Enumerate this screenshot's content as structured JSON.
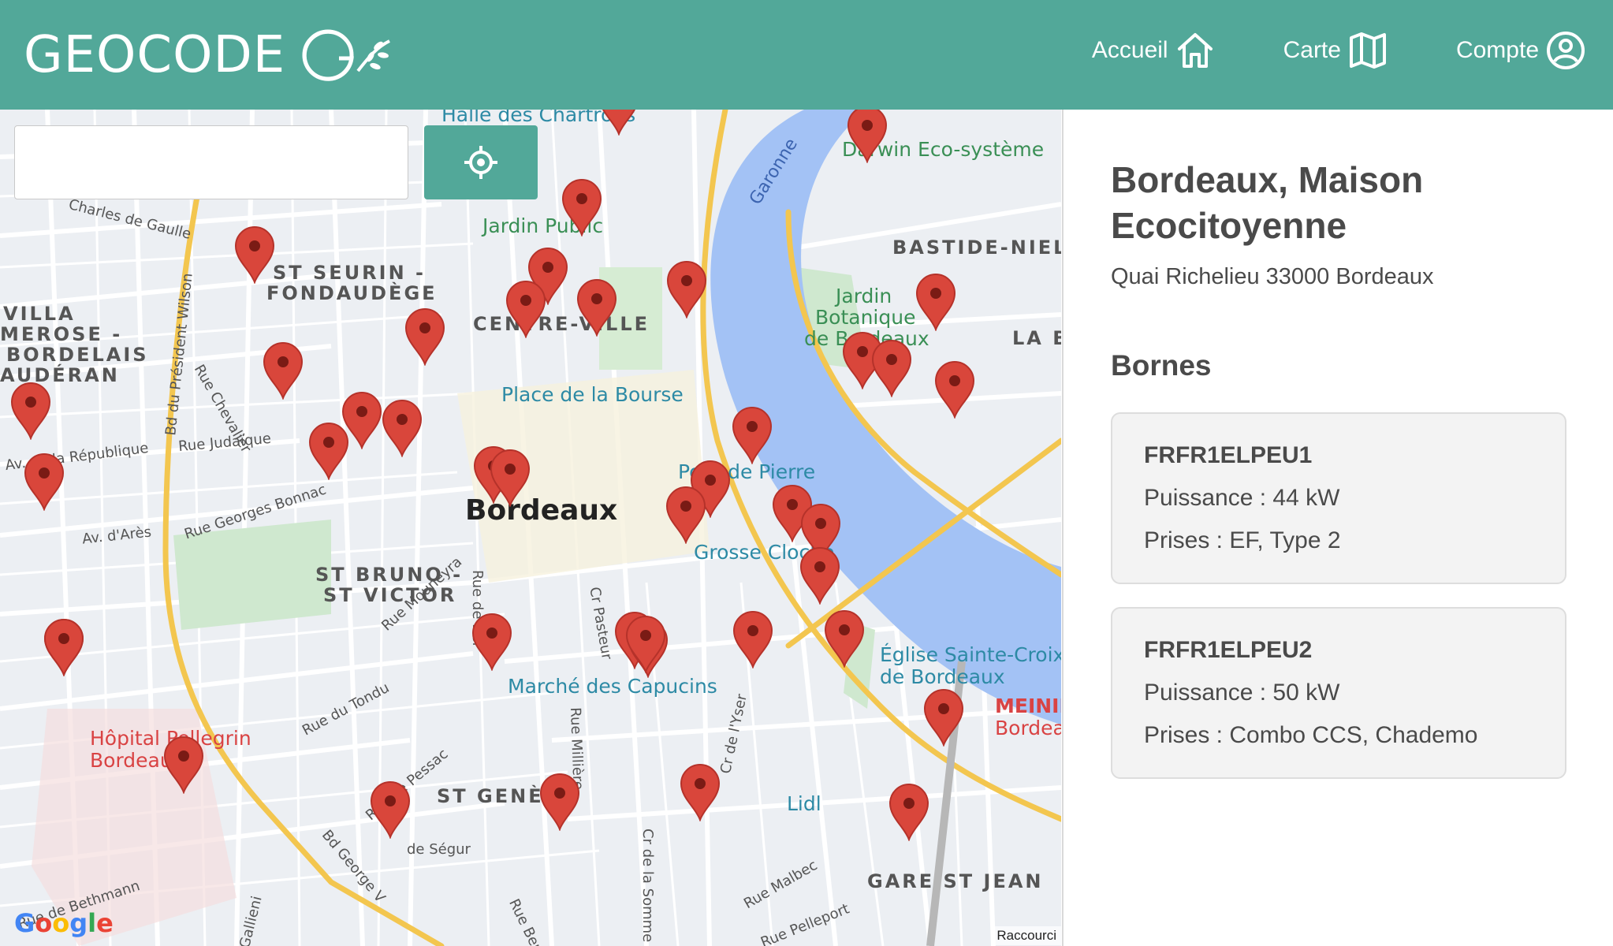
{
  "header": {
    "brand": "GEOCODE",
    "nav": [
      {
        "label": "Accueil",
        "icon": "home-icon"
      },
      {
        "label": "Carte",
        "icon": "map-icon"
      },
      {
        "label": "Compte",
        "icon": "account-icon"
      }
    ]
  },
  "map": {
    "search": {
      "value": "",
      "placeholder": ""
    },
    "districts": [
      "ST SEURIN -",
      "FONDAUDÈGE",
      "VILLA",
      "MEROSE -",
      "BORDELAIS",
      "AUDÉRAN",
      "CENTRE-VILLE",
      "BASTIDE-NIEL",
      "ST BRUNO -",
      "ST VICTOR",
      "ST GENÈS",
      "GARE ST JEAN",
      "LA B"
    ],
    "pois": [
      "Halle des Chartrons",
      "Darwin Eco-système",
      "Jardin Public",
      "Jardin",
      "Botanique",
      "de Bordeaux",
      "Place de la Bourse",
      "Pont de Pierre",
      "Grosse Cloche",
      "Marché des Capucins",
      "Église Sainte-Croix",
      "de Bordeaux",
      "Hôpital Pellegrin",
      "Bordeaux",
      "Lidl",
      "MEININ",
      "Bordea"
    ],
    "city": "Bordeaux",
    "river": "Garonne",
    "roads": [
      "Rue Judaïque",
      "Av. de la République",
      "Av. d'Arès",
      "Rue Georges Bonnac",
      "Bd du Président Wilson",
      "Rue Chevalier",
      "Rue Mouneyra",
      "Rue du Tondu",
      "Rue de Pessac",
      "Bd George V",
      "Rue de Bel",
      "Rue Millière",
      "Cr de l'Yser",
      "Rue Malbec",
      "Cr de la Somme",
      "de Ségur",
      "Rue de Bethmann",
      "Rue Pelleport",
      "Rue Bert",
      "Cr Pasteur",
      "Gallieni",
      "Charles de Gaulle"
    ],
    "google_logo": "Google",
    "shortcuts": "Raccourci",
    "marker_count": 41
  },
  "panel": {
    "title": "Bordeaux, Maison Ecocitoyenne",
    "address": "Quai Richelieu 33000 Bordeaux",
    "section": "Bornes",
    "bornes": [
      {
        "id": "FRFR1ELPEU1",
        "power": "Puissance : 44 kW",
        "plugs": "Prises : EF, Type 2"
      },
      {
        "id": "FRFR1ELPEU2",
        "power": "Puissance : 50 kW",
        "plugs": "Prises : Combo CCS, Chademo"
      }
    ]
  },
  "colors": {
    "brand": "#52a899",
    "marker": "#d9463b",
    "water": "#a3c2f5",
    "major_road": "#f7d98a"
  }
}
